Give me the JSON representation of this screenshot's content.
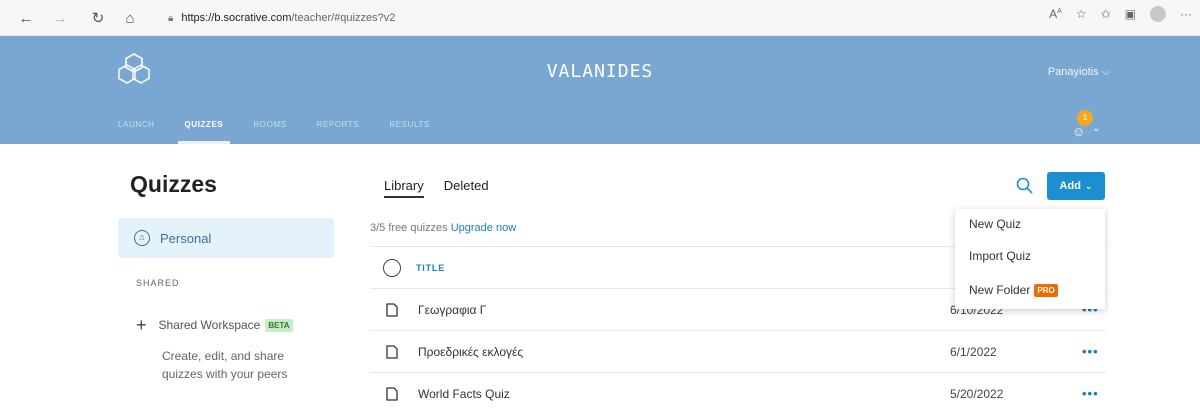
{
  "browser": {
    "url_host": "https://b.socrative.com",
    "url_path": "/teacher/#quizzes?v2"
  },
  "header": {
    "room_name": "VALANIDES",
    "user_name": "Panayiotis",
    "notification_count": "1",
    "tabs": [
      {
        "label": "LAUNCH",
        "active": false
      },
      {
        "label": "QUIZZES",
        "active": true
      },
      {
        "label": "ROOMS",
        "active": false
      },
      {
        "label": "REPORTS",
        "active": false
      },
      {
        "label": "RESULTS",
        "active": false
      }
    ]
  },
  "sidebar": {
    "heading": "Quizzes",
    "personal_label": "Personal",
    "shared_heading": "SHARED",
    "shared_workspace_label": "Shared Workspace",
    "beta_badge": "BETA",
    "shared_description": "Create, edit, and share quizzes with your peers"
  },
  "main": {
    "tabs": [
      {
        "label": "Library",
        "active": true
      },
      {
        "label": "Deleted",
        "active": false
      }
    ],
    "quota_text": "3/5 free quizzes",
    "upgrade_link": "Upgrade now",
    "add_button": "Add",
    "title_header": "TITLE",
    "quizzes": [
      {
        "name": "Γεωγραφια Γ",
        "date": "6/10/2022"
      },
      {
        "name": "Προεδρικές εκλογές",
        "date": "6/1/2022"
      },
      {
        "name": "World Facts Quiz",
        "date": "5/20/2022"
      }
    ],
    "more_label": "•••"
  },
  "add_menu": {
    "items": [
      "New Quiz",
      "Import Quiz",
      "New Folder"
    ],
    "pro_badge": "PRO"
  },
  "colors": {
    "header_bg": "#7aa7d2",
    "accent": "#1b8fd0",
    "link": "#1a7fbd",
    "pro": "#ef6c00"
  }
}
